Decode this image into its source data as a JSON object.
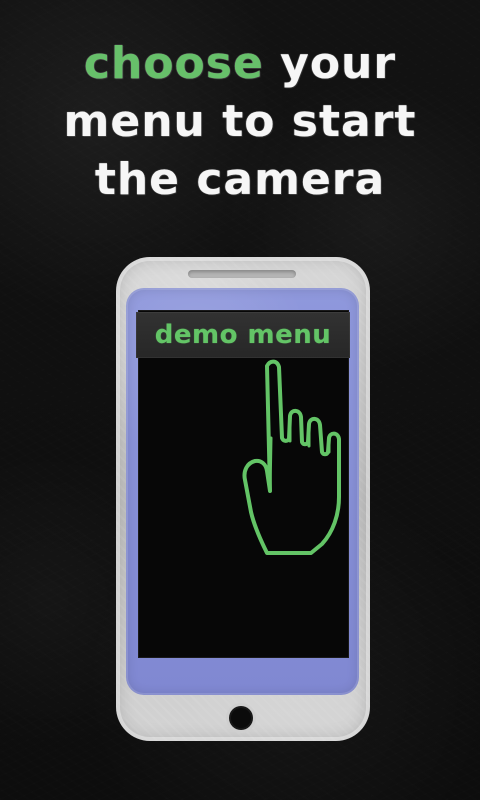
{
  "headline": {
    "accent": "choose",
    "rest": " your menu to start the camera"
  },
  "phone": {
    "menu_label": "demo menu"
  },
  "icons": {
    "hand": "pointing-hand-icon",
    "phone": "smartphone-icon"
  },
  "colors": {
    "accent_green": "#63c466",
    "background": "#0f0f0f",
    "phone_silver": "#cfcfcf",
    "screen_blue": "#8a93d8"
  }
}
